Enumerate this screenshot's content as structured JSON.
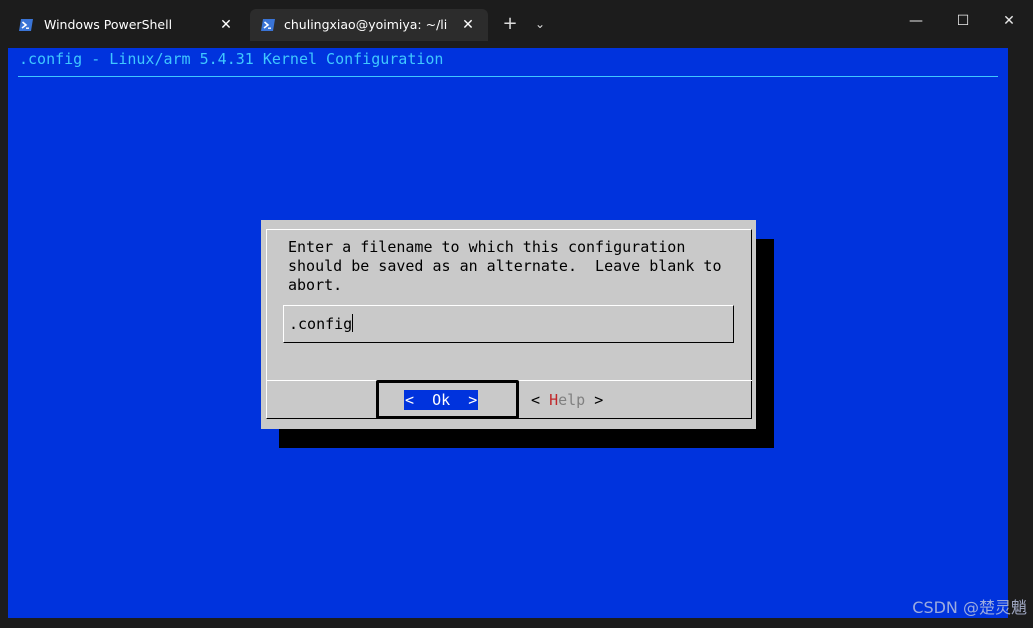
{
  "window": {
    "tabs": [
      {
        "title": "Windows PowerShell",
        "icon": "powershell-icon"
      },
      {
        "title": "chulingxiao@yoimiya: ~/linux",
        "icon": "powershell-icon"
      }
    ],
    "new_tab": "+",
    "tab_dropdown": "⌄",
    "buttons": {
      "minimize": "—",
      "maximize": "☐",
      "close": "✕"
    },
    "tab_close": "✕"
  },
  "terminal": {
    "title": ".config - Linux/arm 5.4.31 Kernel Configuration",
    "colors": {
      "background": "#0033dd",
      "title": "#3fc8ff",
      "dialog": "#c9c9c9"
    }
  },
  "dialog": {
    "message": "Enter a filename to which this configuration\nshould be saved as an alternate.  Leave blank to\nabort.",
    "input_value": ".config",
    "ok_label": "<  Ok  >",
    "help_open": "< ",
    "help_hotkey": "H",
    "help_rest": "elp",
    "help_close": " >"
  },
  "watermark": "CSDN @楚灵魈"
}
